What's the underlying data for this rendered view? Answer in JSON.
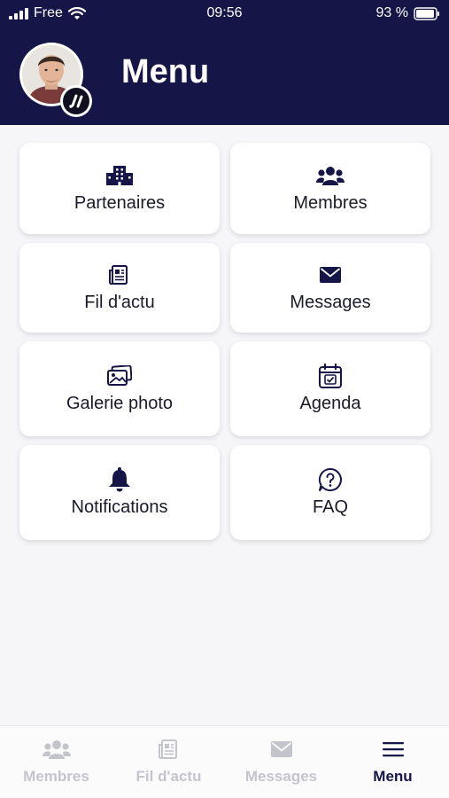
{
  "status_bar": {
    "carrier": "Free",
    "time": "09:56",
    "battery": "93 %"
  },
  "header": {
    "title": "Menu"
  },
  "menu": {
    "items": [
      {
        "label": "Partenaires",
        "icon": "building-icon"
      },
      {
        "label": "Membres",
        "icon": "users-icon"
      },
      {
        "label": "Fil d'actu",
        "icon": "newspaper-icon"
      },
      {
        "label": "Messages",
        "icon": "envelope-icon"
      },
      {
        "label": "Galerie photo",
        "icon": "photo-gallery-icon"
      },
      {
        "label": "Agenda",
        "icon": "calendar-check-icon"
      },
      {
        "label": "Notifications",
        "icon": "bell-icon"
      },
      {
        "label": "FAQ",
        "icon": "question-bubble-icon"
      }
    ]
  },
  "tabbar": {
    "tabs": [
      {
        "label": "Membres",
        "icon": "users-icon",
        "active": false
      },
      {
        "label": "Fil d'actu",
        "icon": "newspaper-icon",
        "active": false
      },
      {
        "label": "Messages",
        "icon": "envelope-icon",
        "active": false
      },
      {
        "label": "Menu",
        "icon": "hamburger-icon",
        "active": true
      }
    ]
  },
  "colors": {
    "primary": "#161547",
    "inactive_tab": "#c4c4cc",
    "background": "#f6f5f8"
  }
}
